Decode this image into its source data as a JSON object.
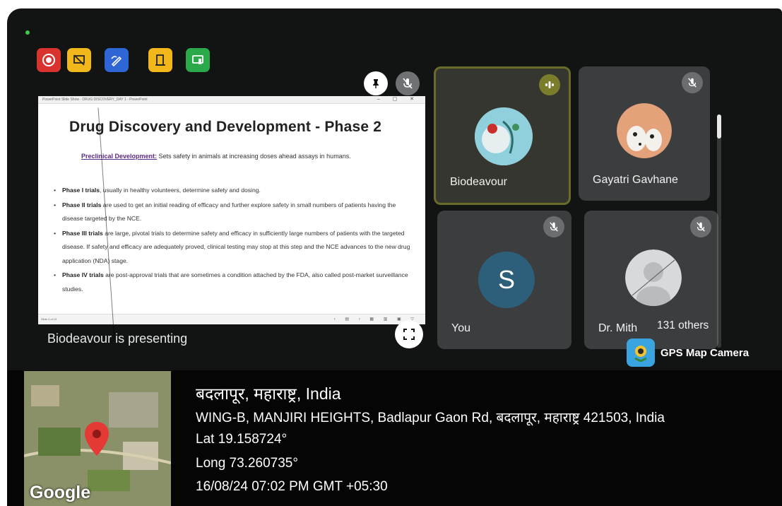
{
  "toolbar": {
    "icons": [
      "record-icon",
      "no-slides-icon",
      "whiteboard-icon",
      "breakout-icon",
      "cast-icon"
    ]
  },
  "slide": {
    "window_title": "PowerPoint Slide Show - DRUG DISCOVERY_DAY 1 - PowerPoint",
    "title": "Drug Discovery and Development - Phase 2",
    "preclinical_label": "Preclinical Development:",
    "preclinical_text": " Sets safety in animals at increasing doses ahead assays in humans.",
    "bullets": [
      {
        "bold": "Phase I trials",
        "text": ", usually in healthy volunteers, determine safety and dosing."
      },
      {
        "bold": "Phase II trials",
        "text": " are used to get an initial reading of efficacy and further explore safety in small numbers of patients having the disease targeted by the NCE."
      },
      {
        "bold": "Phase III trials",
        "text": " are large, pivotal trials to determine safety and efficacy in sufficiently large numbers of patients with the targeted disease. If safety and efficacy are adequately proved, clinical testing may stop at this step and the NCE advances to the new drug application (NDA) stage."
      },
      {
        "bold": "Phase IV trials",
        "text": " are post-approval trials that are sometimes a condition attached by the FDA, also called post-market surveillance studies."
      }
    ],
    "status_left": "Slide 4 of 13"
  },
  "presenting_text": "Biodeavour is presenting",
  "participants": {
    "tile1": {
      "name": "Biodeavour"
    },
    "tile2": {
      "name": "Gayatri Gavhane"
    },
    "tile3": {
      "name": "You",
      "initial": "S"
    },
    "tile4": {
      "name": "Dr. Mith"
    },
    "others": "131 others"
  },
  "colors": {
    "record": "#d9332f",
    "yellow": "#f2b81b",
    "blue": "#2f66d6",
    "green": "#2aa84a"
  },
  "gps": {
    "app_name": "GPS Map Camera",
    "map_label": "Google",
    "city": "बदलापूर, महाराष्ट्र, India",
    "address": "WING-B, MANJIRI HEIGHTS, Badlapur Gaon Rd, बदलापूर, महाराष्ट्र 421503, India",
    "lat": "Lat 19.158724°",
    "long": "Long 73.260735°",
    "datetime": "16/08/24 07:02 PM GMT +05:30"
  }
}
